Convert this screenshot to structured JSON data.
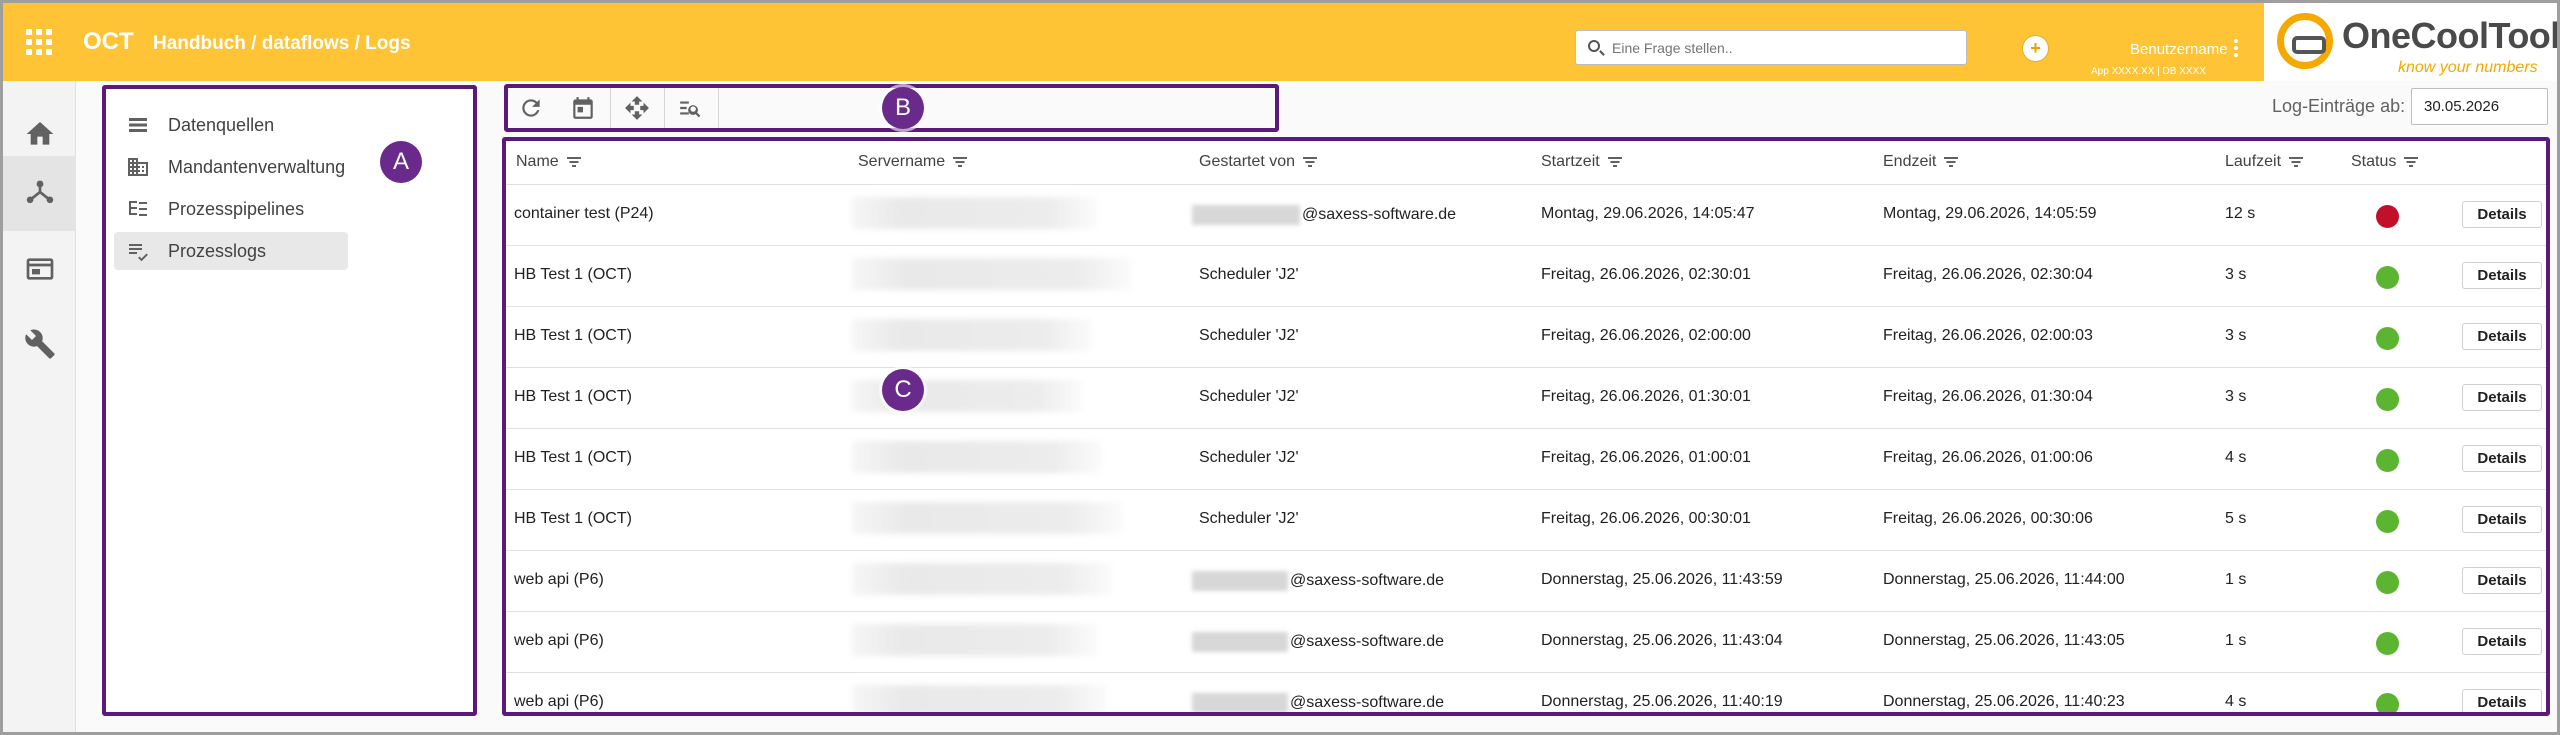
{
  "header": {
    "app_title": "OCT",
    "breadcrumb": "Handbuch / dataflows / Logs",
    "search_placeholder": "Eine Frage stellen..",
    "assistant_symbol": "+",
    "user_name": "Benutzername",
    "version_info": "App XXXX.XX | DB XXXX",
    "logo_name": "OneCoolTool",
    "logo_tagline": "know your numbers"
  },
  "rail": {
    "items": [
      {
        "icon": "home-icon"
      },
      {
        "icon": "dataflow-icon",
        "active": true
      },
      {
        "icon": "window-icon"
      },
      {
        "icon": "wrench-icon"
      }
    ]
  },
  "nav": {
    "items": [
      {
        "label": "Datenquellen",
        "icon": "list-icon"
      },
      {
        "label": "Mandantenverwaltung",
        "icon": "building-icon"
      },
      {
        "label": "Prozesspipelines",
        "icon": "pipeline-icon"
      },
      {
        "label": "Prozesslogs",
        "icon": "log-check-icon",
        "active": true
      }
    ]
  },
  "toolbar": {
    "buttons": [
      {
        "icon": "refresh-icon"
      },
      {
        "icon": "calendar-icon"
      },
      {
        "icon": "move-icon"
      },
      {
        "icon": "search-list-icon"
      }
    ]
  },
  "markers": {
    "a": "A",
    "b": "B",
    "c": "C"
  },
  "filter": {
    "label": "Log-Einträge ab:",
    "date": "30.05.2026"
  },
  "table": {
    "columns": [
      "Name",
      "Servername",
      "Gestartet von",
      "Startzeit",
      "Endzeit",
      "Laufzeit",
      "Status"
    ],
    "details_label": "Details",
    "status_colors": {
      "error": "#c0102a",
      "success": "#5cb531"
    },
    "rows": [
      {
        "name": "container test (P24)",
        "started_by": "@saxess-software.de",
        "start": "Montag, 29.06.2026, 14:05:47",
        "end": "Montag, 29.06.2026, 14:05:59",
        "runtime": "12 s",
        "status": "error"
      },
      {
        "name": "HB Test 1 (OCT)",
        "started_by": "Scheduler 'J2'",
        "start": "Freitag, 26.06.2026, 02:30:01",
        "end": "Freitag, 26.06.2026, 02:30:04",
        "runtime": "3 s",
        "status": "success"
      },
      {
        "name": "HB Test 1 (OCT)",
        "started_by": "Scheduler 'J2'",
        "start": "Freitag, 26.06.2026, 02:00:00",
        "end": "Freitag, 26.06.2026, 02:00:03",
        "runtime": "3 s",
        "status": "success"
      },
      {
        "name": "HB Test 1 (OCT)",
        "started_by": "Scheduler 'J2'",
        "start": "Freitag, 26.06.2026, 01:30:01",
        "end": "Freitag, 26.06.2026, 01:30:04",
        "runtime": "3 s",
        "status": "success"
      },
      {
        "name": "HB Test 1 (OCT)",
        "started_by": "Scheduler 'J2'",
        "start": "Freitag, 26.06.2026, 01:00:01",
        "end": "Freitag, 26.06.2026, 01:00:06",
        "runtime": "4 s",
        "status": "success"
      },
      {
        "name": "HB Test 1 (OCT)",
        "started_by": "Scheduler 'J2'",
        "start": "Freitag, 26.06.2026, 00:30:01",
        "end": "Freitag, 26.06.2026, 00:30:06",
        "runtime": "5 s",
        "status": "success"
      },
      {
        "name": "web api (P6)",
        "started_by": "@saxess-software.de",
        "start": "Donnerstag, 25.06.2026, 11:43:59",
        "end": "Donnerstag, 25.06.2026, 11:44:00",
        "runtime": "1 s",
        "status": "success"
      },
      {
        "name": "web api (P6)",
        "started_by": "@saxess-software.de",
        "start": "Donnerstag, 25.06.2026, 11:43:04",
        "end": "Donnerstag, 25.06.2026, 11:43:05",
        "runtime": "1 s",
        "status": "success"
      },
      {
        "name": "web api (P6)",
        "started_by": "@saxess-software.de",
        "start": "Donnerstag, 25.06.2026, 11:40:19",
        "end": "Donnerstag, 25.06.2026, 11:40:23",
        "runtime": "4 s",
        "status": "success"
      }
    ]
  }
}
